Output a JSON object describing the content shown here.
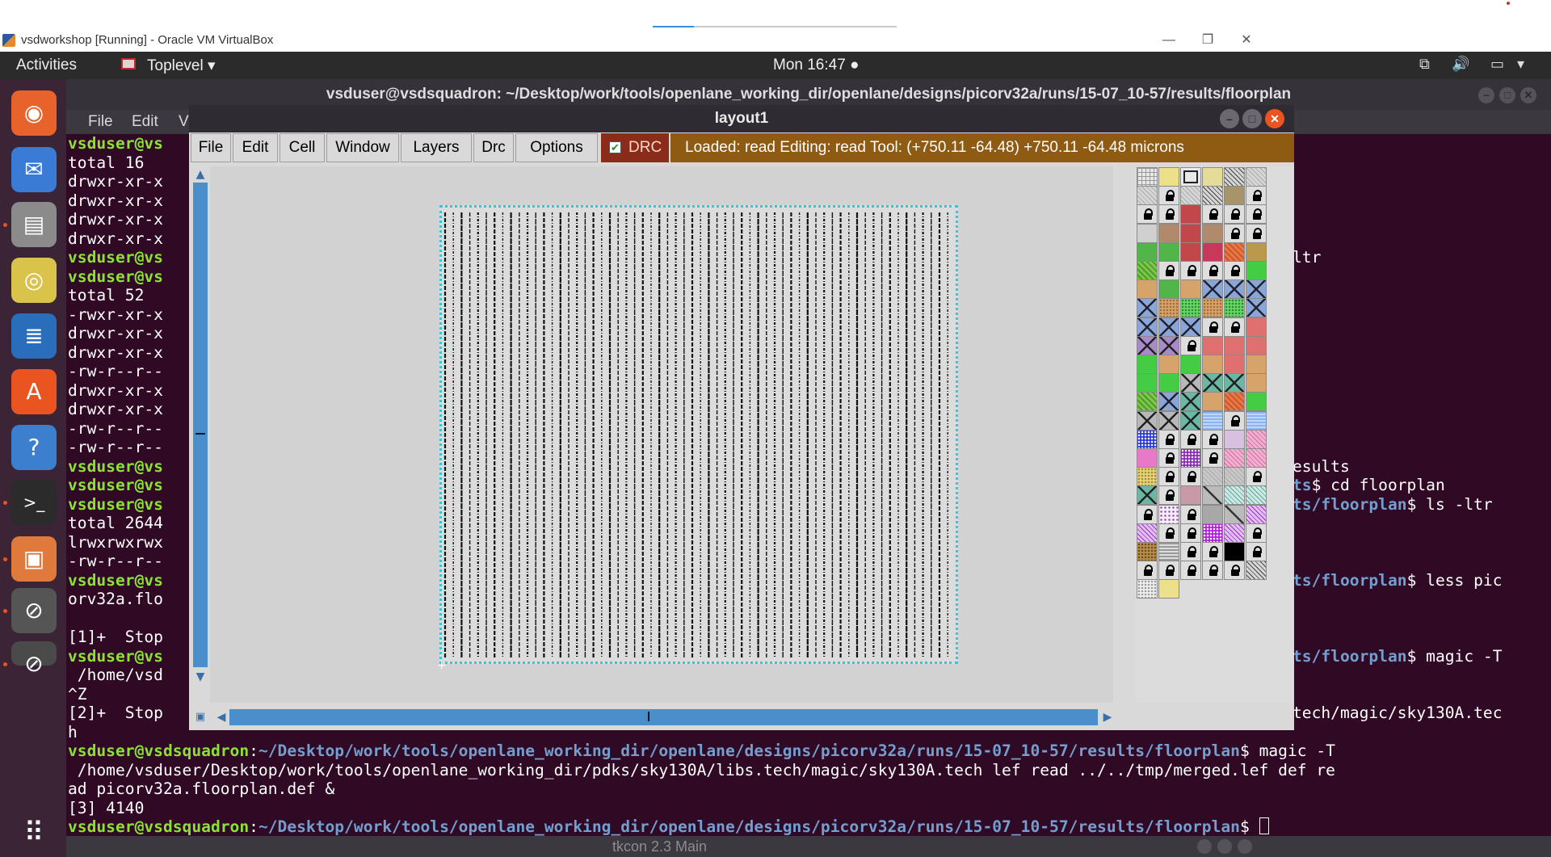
{
  "host": {
    "title": "vsdworkshop [Running] - Oracle VM VirtualBox",
    "minimize": "—",
    "restore": "❐",
    "close": "✕",
    "progress_fraction": 0.17
  },
  "topbar": {
    "activities": "Activities",
    "app_menu": "Toplevel ▾",
    "clock": "Mon 16:47 ●",
    "tray_network": "⧉",
    "tray_volume": "🔊",
    "tray_power": "▭",
    "tray_menu": "▾"
  },
  "dock": {
    "items": [
      {
        "name": "firefox",
        "color": "#e8622b",
        "glyph": "◉"
      },
      {
        "name": "thunderbird",
        "color": "#3a7bd5",
        "glyph": "✉"
      },
      {
        "name": "files",
        "color": "#8b8b8b",
        "glyph": "▤"
      },
      {
        "name": "rhythmbox",
        "color": "#d9c34b",
        "glyph": "◎"
      },
      {
        "name": "libreoffice-writer",
        "color": "#2a6ebb",
        "glyph": "≣"
      },
      {
        "name": "ubuntu-software",
        "color": "#e95420",
        "glyph": "A"
      },
      {
        "name": "help",
        "color": "#3d7fcf",
        "glyph": "?"
      },
      {
        "name": "terminal",
        "color": "#2b2b2b",
        "glyph": ">_"
      },
      {
        "name": "screenshot",
        "color": "#e07a3c",
        "glyph": "▣"
      },
      {
        "name": "blocked-app",
        "color": "#555555",
        "glyph": "⊘"
      },
      {
        "name": "blocked-app-2",
        "color": "#4a4a4a",
        "glyph": "⊘"
      }
    ],
    "show_apps": "⠿"
  },
  "terminal": {
    "title": "vsduser@vsdsquadron: ~/Desktop/work/tools/openlane_working_dir/openlane/designs/picorv32a/runs/15-07_10-57/results/floorplan",
    "menu": [
      "File",
      "Edit",
      "V"
    ],
    "prompt_user": "vsduser@vsdsquadron",
    "prompt_path": "~/Desktop/work/tools/openlane_working_dir/openlane/designs/picorv32a/runs/15-07_10-57/results/floorplan",
    "left_lines": [
      {
        "type": "prompt",
        "text": "vsduser@vs"
      },
      {
        "type": "plain",
        "text": "total 16"
      },
      {
        "type": "plain",
        "text": "drwxr-xr-x"
      },
      {
        "type": "plain",
        "text": "drwxr-xr-x"
      },
      {
        "type": "plain",
        "text": "drwxr-xr-x"
      },
      {
        "type": "plain",
        "text": "drwxr-xr-x"
      },
      {
        "type": "prompt",
        "text": "vsduser@vs"
      },
      {
        "type": "prompt",
        "text": "vsduser@vs"
      },
      {
        "type": "plain",
        "text": "total 52"
      },
      {
        "type": "plain",
        "text": "-rwxr-xr-x"
      },
      {
        "type": "plain",
        "text": "drwxr-xr-x"
      },
      {
        "type": "plain",
        "text": "drwxr-xr-x"
      },
      {
        "type": "plain",
        "text": "-rw-r--r--"
      },
      {
        "type": "plain",
        "text": "drwxr-xr-x"
      },
      {
        "type": "plain",
        "text": "drwxr-xr-x"
      },
      {
        "type": "plain",
        "text": "-rw-r--r--"
      },
      {
        "type": "plain",
        "text": "-rw-r--r--"
      },
      {
        "type": "prompt",
        "text": "vsduser@vs"
      },
      {
        "type": "prompt",
        "text": "vsduser@vs"
      },
      {
        "type": "prompt",
        "text": "vsduser@vs"
      },
      {
        "type": "plain",
        "text": "total 2644"
      },
      {
        "type": "plain",
        "text": "lrwxrwxrwx"
      },
      {
        "type": "plain",
        "text": "-rw-r--r--"
      },
      {
        "type": "prompt",
        "text": "vsduser@vs"
      },
      {
        "type": "plain",
        "text": "orv32a.flo"
      },
      {
        "type": "plain",
        "text": ""
      },
      {
        "type": "plain",
        "text": "[1]+  Stop"
      },
      {
        "type": "prompt",
        "text": "vsduser@vs"
      },
      {
        "type": "plain",
        "text": " /home/vsd"
      },
      {
        "type": "plain",
        "text": "^Z"
      },
      {
        "type": "plain",
        "text": "[2]+  Stop"
      },
      {
        "type": "plain",
        "text": "h"
      }
    ],
    "right_lines": [
      {
        "row": 6,
        "type": "plain",
        "text": "ltr"
      },
      {
        "row": 17,
        "type": "plain",
        "text": "esults"
      },
      {
        "row": 18,
        "type": "mixed",
        "blue": "ts",
        "white": "$ cd floorplan"
      },
      {
        "row": 19,
        "type": "mixed",
        "blue": "ts/floorplan",
        "white": "$ ls -ltr"
      },
      {
        "row": 23,
        "type": "mixed",
        "blue": "ts/floorplan",
        "white": "$ less pic"
      },
      {
        "row": 27,
        "type": "mixed",
        "blue": "ts/floorplan",
        "white": "$ magic -T"
      },
      {
        "row": 30,
        "type": "plain",
        "text": "tech/magic/sky130A.tec"
      }
    ],
    "bottom_lines": [
      {
        "type": "prompt_cmd",
        "cmd": "$ magic -T"
      },
      {
        "type": "plain",
        "text": " /home/vsduser/Desktop/work/tools/openlane_working_dir/pdks/sky130A/libs.tech/magic/sky130A.tech lef read ../../tmp/merged.lef def re"
      },
      {
        "type": "plain",
        "text": "ad picorv32a.floorplan.def &"
      },
      {
        "type": "plain",
        "text": "[3] 4140"
      },
      {
        "type": "prompt_cmd",
        "cmd": "$ "
      }
    ],
    "tkcon_title": "tkcon 2.3 Main"
  },
  "magic": {
    "title": "layout1",
    "menu": [
      "File",
      "Edit",
      "Cell",
      "Window",
      "Layers",
      "Drc",
      "Options"
    ],
    "drc_label": "DRC",
    "drc_checked": true,
    "status": "Loaded: read Editing: read Tool:     (+750.11 -64.48) +750.11 -64.48 microns",
    "palette": [
      [
        "grid",
        "yellow",
        "box",
        "khaki",
        "hatch",
        "hatchl"
      ],
      [
        "hatchl",
        "lock",
        "hatchl",
        "hatch",
        "tan",
        "lock"
      ],
      [
        "lock",
        "lock",
        "red",
        "lock",
        "lock",
        "lock"
      ],
      [
        "gray",
        "brown",
        "red",
        "brown",
        "lock",
        "lock"
      ],
      [
        "green",
        "green",
        "red",
        "crimson",
        "orange",
        "olive"
      ],
      [
        "lime",
        "lock",
        "lock",
        "lock",
        "lock",
        "brightgreen"
      ],
      [
        "sand",
        "green",
        "sand",
        "xblue",
        "xblue",
        "xblue"
      ],
      [
        "xblue",
        "dotsand",
        "dotgreen",
        "dotsand",
        "dotgreen",
        "xblue"
      ],
      [
        "xblue",
        "xblue",
        "xblue",
        "lock",
        "lock",
        "salmon"
      ],
      [
        "xpurple",
        "xpurple",
        "lock",
        "salmon",
        "salmon",
        "salmon"
      ],
      [
        "brightgreen",
        "sand",
        "brightgreen",
        "sand",
        "salmon",
        "sand"
      ],
      [
        "brightgreen",
        "brightgreen",
        "xgray",
        "xteal",
        "xteal",
        "sand"
      ],
      [
        "lime",
        "xblue",
        "xteal",
        "sand",
        "orange",
        "brightgreen"
      ],
      [
        "xgray",
        "xgray",
        "xteal",
        "lightblue",
        "lock",
        "lightblue"
      ],
      [
        "navy",
        "lock",
        "lock",
        "lock",
        "lilac",
        "pinkh"
      ],
      [
        "magenta",
        "lock",
        "purple",
        "lock",
        "pinkh",
        "pinkh"
      ],
      [
        "yellowdot",
        "lock",
        "lock",
        "graydot",
        "graydot",
        "lock"
      ],
      [
        "xteal",
        "lock",
        "mauve",
        "diag",
        "tealh",
        "tealh"
      ],
      [
        "lock",
        "dotpurple",
        "lock",
        "gray2",
        "diag",
        "violet"
      ],
      [
        "violet",
        "lock",
        "lock",
        "purpledot",
        "violet",
        "lock"
      ],
      [
        "brownbrick",
        "stripes",
        "lock",
        "lock",
        "black",
        "lock"
      ],
      [
        "lock",
        "lock",
        "lock",
        "lock",
        "lock",
        "hatch"
      ],
      [
        "dotwhite",
        "yellow"
      ]
    ]
  },
  "colors": {
    "terminal_bg": "#300a24",
    "prompt_green": "#8ae234",
    "path_blue": "#729fcf",
    "die_outline": "#33c8d8",
    "drc_red": "#8b2c1a",
    "status_brown": "#8f5a12"
  }
}
